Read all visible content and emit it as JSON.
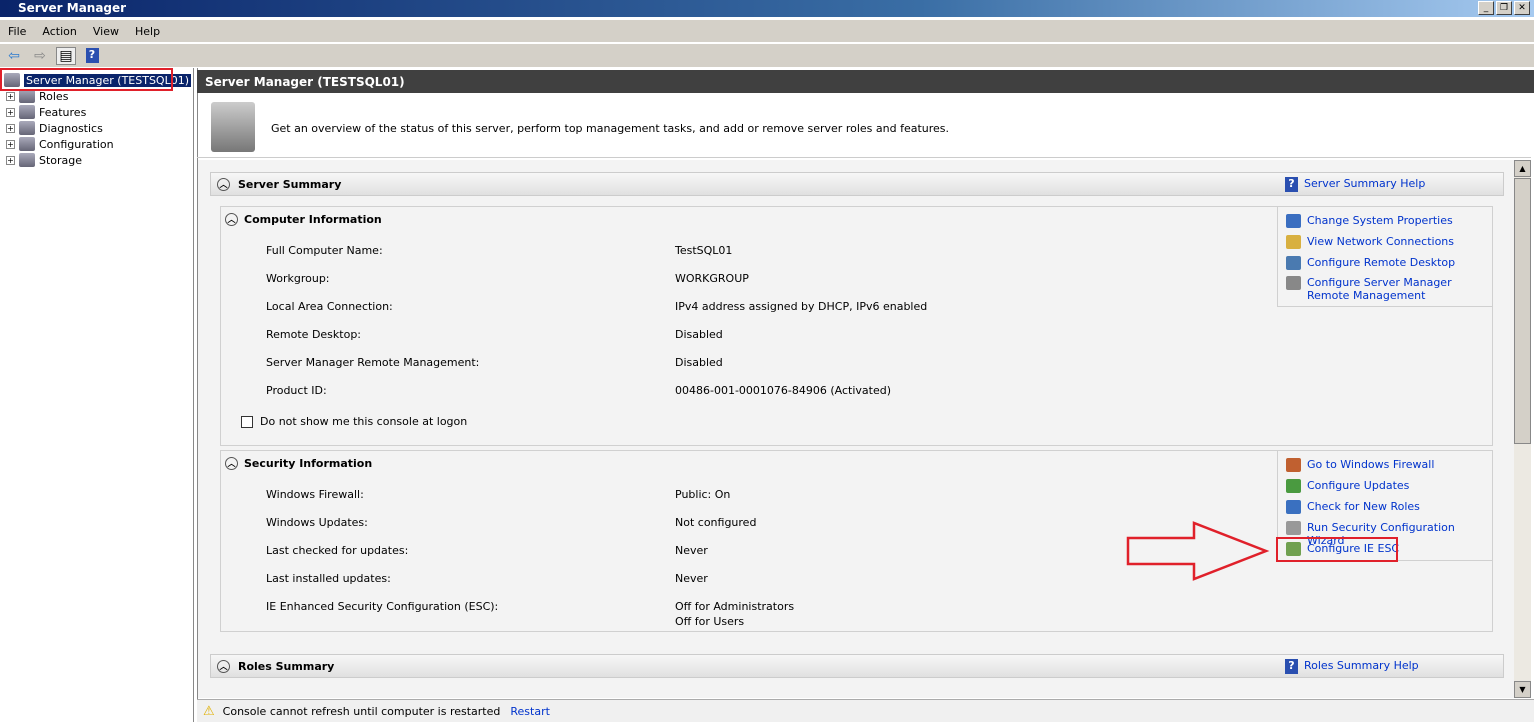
{
  "window": {
    "title": "Server Manager"
  },
  "menu": [
    "File",
    "Action",
    "View",
    "Help"
  ],
  "tree": {
    "root": "Server Manager (TESTSQL01)",
    "items": [
      "Roles",
      "Features",
      "Diagnostics",
      "Configuration",
      "Storage"
    ]
  },
  "pane": {
    "header": "Server Manager (TESTSQL01)",
    "intro": "Get an overview of the status of this server, perform top management tasks, and add or remove server roles and features."
  },
  "server_summary": {
    "title": "Server Summary",
    "help": "Server Summary Help",
    "computer": {
      "title": "Computer Information",
      "rows": [
        {
          "label": "Full Computer Name:",
          "value": "TestSQL01"
        },
        {
          "label": "Workgroup:",
          "value": "WORKGROUP"
        },
        {
          "label": "Local Area Connection:",
          "value": "IPv4 address assigned by DHCP, IPv6 enabled"
        },
        {
          "label": "Remote Desktop:",
          "value": "Disabled"
        },
        {
          "label": "Server Manager Remote Management:",
          "value": "Disabled"
        },
        {
          "label": "Product ID:",
          "value": "00486-001-0001076-84906 (Activated)"
        }
      ],
      "checkbox": "Do not show me this console at logon",
      "tasks": [
        "Change System Properties",
        "View Network Connections",
        "Configure Remote Desktop",
        "Configure Server Manager Remote Management"
      ]
    },
    "security": {
      "title": "Security Information",
      "rows": [
        {
          "label": "Windows Firewall:",
          "value": "Public: On"
        },
        {
          "label": "Windows Updates:",
          "value": "Not configured"
        },
        {
          "label": "Last checked for updates:",
          "value": "Never"
        },
        {
          "label": "Last installed updates:",
          "value": "Never"
        },
        {
          "label": "IE Enhanced Security Configuration (ESC):",
          "value": "Off for Administrators",
          "value2": "Off for Users"
        }
      ],
      "tasks": [
        "Go to Windows Firewall",
        "Configure Updates",
        "Check for New Roles",
        "Run Security Configuration Wizard",
        "Configure IE ESC"
      ]
    }
  },
  "roles_summary": {
    "title": "Roles Summary",
    "help": "Roles Summary Help"
  },
  "status": {
    "message": "Console cannot refresh until computer is restarted",
    "link": "Restart"
  },
  "colors": {
    "annotation": "#e0202a",
    "link": "#0033cc"
  }
}
